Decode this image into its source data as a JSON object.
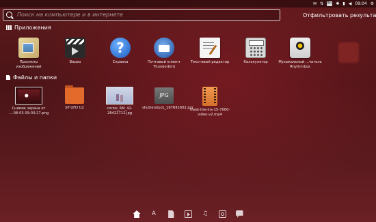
{
  "topbar": {
    "keyboard_layout": "En",
    "clock": "09:04",
    "icons": [
      "mail-icon",
      "network-icon",
      "bluetooth-icon",
      "keyboard-icon",
      "battery-icon",
      "volume-icon",
      "gear-icon"
    ]
  },
  "search": {
    "placeholder": "Поиск на компьютере и в интернете",
    "filter_label": "Отфильтровать результаты"
  },
  "applications": {
    "heading": "Приложения",
    "items": [
      {
        "label": "Просмотр изображений",
        "icon": "image-viewer-icon"
      },
      {
        "label": "Видео",
        "icon": "video-player-icon"
      },
      {
        "label": "Справка",
        "icon": "help-icon"
      },
      {
        "label": "Почтовый клиент Thunderbird",
        "icon": "thunderbird-icon"
      },
      {
        "label": "Текстовый редактор",
        "icon": "text-editor-icon"
      },
      {
        "label": "Калькулятор",
        "icon": "calculator-icon"
      },
      {
        "label": "Музыкальный ...чатель Rhythmbox",
        "icon": "rhythmbox-icon"
      }
    ]
  },
  "files": {
    "heading": "Файлы и папки",
    "items": [
      {
        "label": "Снимок экрана от ...-08-03 09:03:27.png",
        "thumb": "screenshot"
      },
      {
        "label": "SP UFD U2",
        "thumb": "folder"
      },
      {
        "label": "corbis_RM_42-28422712.jpg",
        "thumb": "photo"
      },
      {
        "label": "shutterstock_167691602.jpg",
        "thumb": "jpg-icon"
      },
      {
        "label": "meet-the-ins-15-7000-video-v2.mp4",
        "thumb": "video-file"
      }
    ],
    "jpg_text": "JPG"
  },
  "dock": {
    "lenses": [
      "home-lens-icon",
      "applications-lens-icon",
      "files-lens-icon",
      "video-lens-icon",
      "music-lens-icon",
      "photos-lens-icon",
      "social-lens-icon"
    ],
    "apps_glyph": "A",
    "music_glyph": "♫"
  }
}
